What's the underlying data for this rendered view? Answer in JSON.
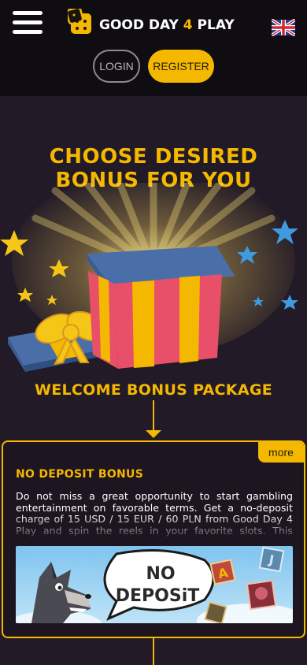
{
  "header": {
    "logo_text_a": "GOOD DAY ",
    "logo_text_b": "4",
    "logo_text_c": " PLAY",
    "menu_icon": "hamburger-menu-icon",
    "language_icon": "uk-flag-icon",
    "login_label": "LOGIN",
    "register_label": "REGISTER"
  },
  "hero": {
    "title": "CHOOSE DESIRED BONUS FOR YOU",
    "package_label": "WELCOME BONUS PACKAGE"
  },
  "bonus_card": {
    "more_label": "more",
    "title": "NO DEPOSIT BONUS",
    "text": "Do not miss a great opportunity to start gambling entertainment on favorable terms. Get a no-deposit charge of 15 USD / 15 EUR / 60 PLN from Good Day 4 Play and spin the reels in your favorite slots. This welcome bonus is available to",
    "image_text_1": "NO",
    "image_text_2": "DEPOSiT"
  },
  "colors": {
    "background": "#221a26",
    "header_background": "#0f0c12",
    "accent": "#f5b800",
    "gift_red": "#e8506a",
    "gift_yellow": "#f5b800",
    "gift_blue": "#4a6fa8"
  }
}
